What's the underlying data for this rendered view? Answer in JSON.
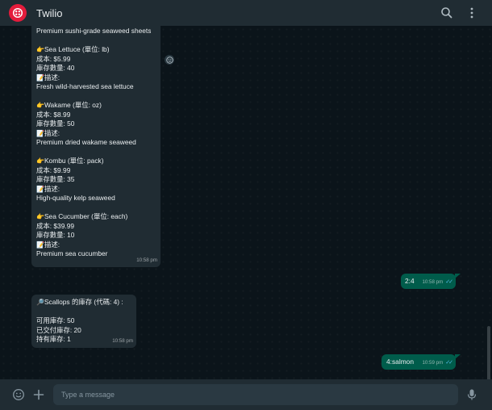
{
  "header": {
    "title": "Twilio",
    "icons": [
      "twilio-logo",
      "search-icon",
      "more-vert-icon"
    ]
  },
  "colors": {
    "background": "#0b141a",
    "header": "#202c33",
    "incoming_bubble": "#202c33",
    "outgoing_bubble": "#005c4b",
    "read_ticks": "#53bdeb",
    "brand": "#e41c3c"
  },
  "messages": {
    "m1": {
      "line1": "Premium sushi-grade seaweed sheets",
      "item2": {
        "name": "Sea Lettuce (單位: lb)",
        "cost": "成本: $5.99",
        "stock": "庫存數量: 40",
        "desc_label": "描述:",
        "desc": "Fresh wild-harvested sea lettuce"
      },
      "item3": {
        "name": "Wakame (單位: oz)",
        "cost": "成本: $8.99",
        "stock": "庫存數量: 50",
        "desc_label": "描述:",
        "desc": "Premium dried wakame seaweed"
      },
      "item4": {
        "name": "Kombu (單位: pack)",
        "cost": "成本: $9.99",
        "stock": "庫存數量: 35",
        "desc_label": "描述:",
        "desc": "High-quality kelp seaweed"
      },
      "item5": {
        "name": "Sea Cucumber (單位: each)",
        "cost": "成本: $39.99",
        "stock": "庫存數量: 10",
        "desc_label": "描述:",
        "desc": "Premium sea cucumber"
      },
      "time": "10:58 pm"
    },
    "m2": {
      "text": "2:4",
      "time": "10:58 pm"
    },
    "m3": {
      "title": "Scallops 的庫存 (代碼: 4) :",
      "available": "可用庫存: 50",
      "delivered": "已交付庫存: 20",
      "held": "持有庫存: 1",
      "time": "10:58 pm"
    },
    "m4": {
      "text": "4:salmon",
      "time": "10:59 pm"
    }
  },
  "footer": {
    "placeholder": "Type a message",
    "icons": [
      "emoji-icon",
      "plus-icon",
      "mic-icon"
    ]
  }
}
